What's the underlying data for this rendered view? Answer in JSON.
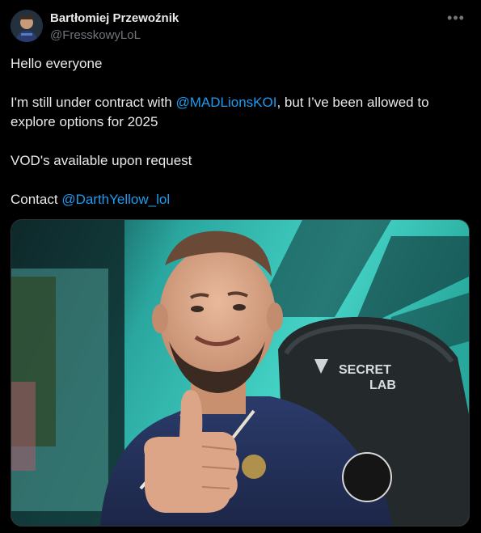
{
  "author": {
    "display_name": "Bartłomiej Przewoźnik",
    "handle": "@FresskowyLoL"
  },
  "post": {
    "line1": "Hello everyone",
    "line2_prefix": "I'm still under contract with ",
    "line2_mention": "@MADLionsKOI",
    "line2_suffix": ", but I’ve been allowed to",
    "line3": "explore options for 2025",
    "line4": "VOD's available upon request",
    "line5_prefix": "Contact ",
    "line5_mention": "@DarthYellow_lol"
  },
  "photo": {
    "chair_brand_line1": "SECRET",
    "chair_brand_line2": "LAB"
  },
  "icons": {
    "more": "more-dots-icon",
    "avatar": "avatar"
  },
  "colors": {
    "background": "#000000",
    "text": "#e7e9ea",
    "secondary": "#71767b",
    "link": "#1d9bf0"
  }
}
